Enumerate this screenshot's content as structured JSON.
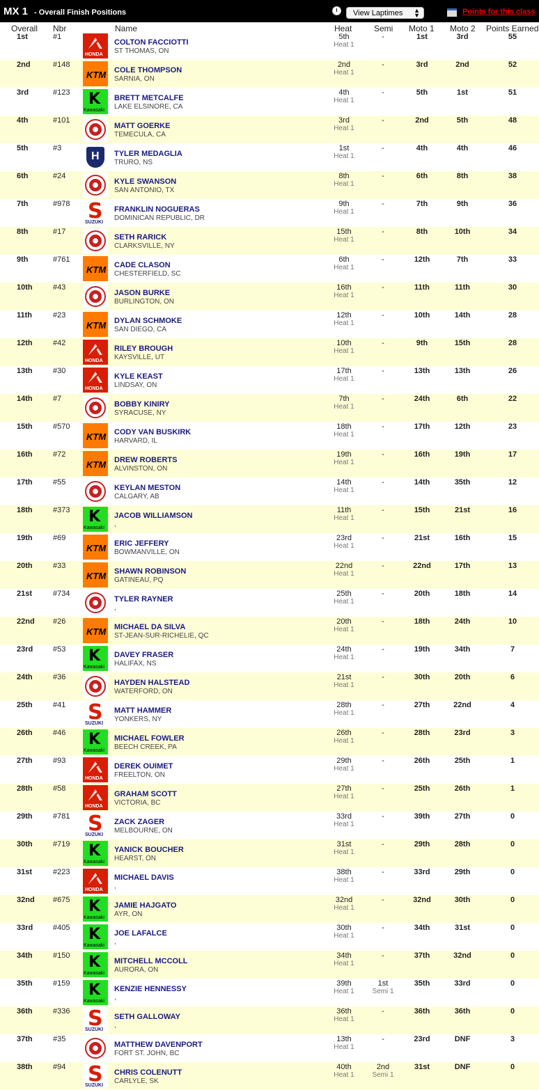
{
  "header": {
    "class_name": "MX 1",
    "subtitle": "- Overall Finish Positions",
    "laptimes_select": "View Laptimes",
    "points_link": "Points for this class"
  },
  "columns": {
    "overall": "Overall",
    "nbr": "Nbr",
    "name": "Name",
    "heat": "Heat",
    "semi": "Semi",
    "moto1": "Moto 1",
    "moto2": "Moto 2",
    "points": "Points Earned"
  },
  "brand_icons": {
    "honda": "honda-logo-icon",
    "ktm": "ktm-logo-icon",
    "kawasaki": "kawasaki-logo-icon",
    "yamaha": "yamaha-logo-icon",
    "husqvarna": "husqvarna-logo-icon",
    "suzuki": "suzuki-logo-icon"
  },
  "rows": [
    {
      "pos": "1st",
      "nbr": "#1",
      "brand": "honda",
      "name": "COLTON FACCIOTTI",
      "hometown": "ST THOMAS, ON",
      "heat": "5th",
      "heat_sub": "Heat 1",
      "semi": "-",
      "semi_sub": "",
      "moto1": "1st",
      "moto2": "3rd",
      "points": "55"
    },
    {
      "pos": "2nd",
      "nbr": "#148",
      "brand": "ktm",
      "name": "COLE THOMPSON",
      "hometown": "SARNIA, ON",
      "heat": "2nd",
      "heat_sub": "Heat 1",
      "semi": "-",
      "semi_sub": "",
      "moto1": "3rd",
      "moto2": "2nd",
      "points": "52"
    },
    {
      "pos": "3rd",
      "nbr": "#123",
      "brand": "kawasaki",
      "name": "BRETT METCALFE",
      "hometown": "LAKE ELSINORE, CA",
      "heat": "4th",
      "heat_sub": "Heat 1",
      "semi": "-",
      "semi_sub": "",
      "moto1": "5th",
      "moto2": "1st",
      "points": "51"
    },
    {
      "pos": "4th",
      "nbr": "#101",
      "brand": "yamaha",
      "name": "MATT GOERKE",
      "hometown": "TEMECULA, CA",
      "heat": "3rd",
      "heat_sub": "Heat 1",
      "semi": "-",
      "semi_sub": "",
      "moto1": "2nd",
      "moto2": "5th",
      "points": "48"
    },
    {
      "pos": "5th",
      "nbr": "#3",
      "brand": "husqvarna",
      "name": "TYLER MEDAGLIA",
      "hometown": "TRURO, NS",
      "heat": "1st",
      "heat_sub": "Heat 1",
      "semi": "-",
      "semi_sub": "",
      "moto1": "4th",
      "moto2": "4th",
      "points": "46"
    },
    {
      "pos": "6th",
      "nbr": "#24",
      "brand": "yamaha",
      "name": "KYLE SWANSON",
      "hometown": "SAN ANTONIO, TX",
      "heat": "8th",
      "heat_sub": "Heat 1",
      "semi": "-",
      "semi_sub": "",
      "moto1": "6th",
      "moto2": "8th",
      "points": "38"
    },
    {
      "pos": "7th",
      "nbr": "#978",
      "brand": "suzuki",
      "name": "FRANKLIN NOGUERAS",
      "hometown": "DOMINICAN REPUBLIC, DR",
      "heat": "9th",
      "heat_sub": "Heat 1",
      "semi": "-",
      "semi_sub": "",
      "moto1": "7th",
      "moto2": "9th",
      "points": "36"
    },
    {
      "pos": "8th",
      "nbr": "#17",
      "brand": "yamaha",
      "name": "SETH RARICK",
      "hometown": "CLARKSVILLE, NY",
      "heat": "15th",
      "heat_sub": "Heat 1",
      "semi": "-",
      "semi_sub": "",
      "moto1": "8th",
      "moto2": "10th",
      "points": "34"
    },
    {
      "pos": "9th",
      "nbr": "#761",
      "brand": "ktm",
      "name": "CADE CLASON",
      "hometown": "CHESTERFIELD, SC",
      "heat": "6th",
      "heat_sub": "Heat 1",
      "semi": "-",
      "semi_sub": "",
      "moto1": "12th",
      "moto2": "7th",
      "points": "33"
    },
    {
      "pos": "10th",
      "nbr": "#43",
      "brand": "yamaha",
      "name": "JASON BURKE",
      "hometown": "BURLINGTON, ON",
      "heat": "16th",
      "heat_sub": "Heat 1",
      "semi": "-",
      "semi_sub": "",
      "moto1": "11th",
      "moto2": "11th",
      "points": "30"
    },
    {
      "pos": "11th",
      "nbr": "#23",
      "brand": "ktm",
      "name": "DYLAN SCHMOKE",
      "hometown": "SAN DIEGO, CA",
      "heat": "12th",
      "heat_sub": "Heat 1",
      "semi": "-",
      "semi_sub": "",
      "moto1": "10th",
      "moto2": "14th",
      "points": "28"
    },
    {
      "pos": "12th",
      "nbr": "#42",
      "brand": "honda",
      "name": "RILEY BROUGH",
      "hometown": "KAYSVILLE, UT",
      "heat": "10th",
      "heat_sub": "Heat 1",
      "semi": "-",
      "semi_sub": "",
      "moto1": "9th",
      "moto2": "15th",
      "points": "28"
    },
    {
      "pos": "13th",
      "nbr": "#30",
      "brand": "honda",
      "name": "KYLE KEAST",
      "hometown": "LINDSAY, ON",
      "heat": "17th",
      "heat_sub": "Heat 1",
      "semi": "-",
      "semi_sub": "",
      "moto1": "13th",
      "moto2": "13th",
      "points": "26"
    },
    {
      "pos": "14th",
      "nbr": "#7",
      "brand": "yamaha",
      "name": "BOBBY KINIRY",
      "hometown": "SYRACUSE, NY",
      "heat": "7th",
      "heat_sub": "Heat 1",
      "semi": "-",
      "semi_sub": "",
      "moto1": "24th",
      "moto2": "6th",
      "points": "22"
    },
    {
      "pos": "15th",
      "nbr": "#570",
      "brand": "ktm",
      "name": "CODY VAN BUSKIRK",
      "hometown": "HARVARD, IL",
      "heat": "18th",
      "heat_sub": "Heat 1",
      "semi": "-",
      "semi_sub": "",
      "moto1": "17th",
      "moto2": "12th",
      "points": "23"
    },
    {
      "pos": "16th",
      "nbr": "#72",
      "brand": "ktm",
      "name": "DREW ROBERTS",
      "hometown": "ALVINSTON, ON",
      "heat": "19th",
      "heat_sub": "Heat 1",
      "semi": "-",
      "semi_sub": "",
      "moto1": "16th",
      "moto2": "19th",
      "points": "17"
    },
    {
      "pos": "17th",
      "nbr": "#55",
      "brand": "yamaha",
      "name": "KEYLAN MESTON",
      "hometown": "CALGARY, AB",
      "heat": "14th",
      "heat_sub": "Heat 1",
      "semi": "-",
      "semi_sub": "",
      "moto1": "14th",
      "moto2": "35th",
      "points": "12"
    },
    {
      "pos": "18th",
      "nbr": "#373",
      "brand": "kawasaki",
      "name": "JACOB WILLIAMSON",
      "hometown": ",",
      "heat": "11th",
      "heat_sub": "Heat 1",
      "semi": "-",
      "semi_sub": "",
      "moto1": "15th",
      "moto2": "21st",
      "points": "16"
    },
    {
      "pos": "19th",
      "nbr": "#69",
      "brand": "ktm",
      "name": "ERIC JEFFERY",
      "hometown": "BOWMANVILLE, ON",
      "heat": "23rd",
      "heat_sub": "Heat 1",
      "semi": "-",
      "semi_sub": "",
      "moto1": "21st",
      "moto2": "16th",
      "points": "15"
    },
    {
      "pos": "20th",
      "nbr": "#33",
      "brand": "ktm",
      "name": "SHAWN ROBINSON",
      "hometown": "GATINEAU, PQ",
      "heat": "22nd",
      "heat_sub": "Heat 1",
      "semi": "-",
      "semi_sub": "",
      "moto1": "22nd",
      "moto2": "17th",
      "points": "13"
    },
    {
      "pos": "21st",
      "nbr": "#734",
      "brand": "yamaha",
      "name": "TYLER RAYNER",
      "hometown": ",",
      "heat": "25th",
      "heat_sub": "Heat 1",
      "semi": "-",
      "semi_sub": "",
      "moto1": "20th",
      "moto2": "18th",
      "points": "14"
    },
    {
      "pos": "22nd",
      "nbr": "#26",
      "brand": "ktm",
      "name": "MICHAEL DA SILVA",
      "hometown": "ST-JEAN-SUR-RICHELIE, QC",
      "heat": "20th",
      "heat_sub": "Heat 1",
      "semi": "-",
      "semi_sub": "",
      "moto1": "18th",
      "moto2": "24th",
      "points": "10"
    },
    {
      "pos": "23rd",
      "nbr": "#53",
      "brand": "kawasaki",
      "name": "DAVEY FRASER",
      "hometown": "HALIFAX, NS",
      "heat": "24th",
      "heat_sub": "Heat 1",
      "semi": "-",
      "semi_sub": "",
      "moto1": "19th",
      "moto2": "34th",
      "points": "7"
    },
    {
      "pos": "24th",
      "nbr": "#36",
      "brand": "yamaha",
      "name": "HAYDEN HALSTEAD",
      "hometown": "WATERFORD, ON",
      "heat": "21st",
      "heat_sub": "Heat 1",
      "semi": "-",
      "semi_sub": "",
      "moto1": "30th",
      "moto2": "20th",
      "points": "6"
    },
    {
      "pos": "25th",
      "nbr": "#41",
      "brand": "suzuki",
      "name": "MATT HAMMER",
      "hometown": "YONKERS, NY",
      "heat": "28th",
      "heat_sub": "Heat 1",
      "semi": "-",
      "semi_sub": "",
      "moto1": "27th",
      "moto2": "22nd",
      "points": "4"
    },
    {
      "pos": "26th",
      "nbr": "#46",
      "brand": "kawasaki",
      "name": "MICHAEL FOWLER",
      "hometown": "BEECH CREEK, PA",
      "heat": "26th",
      "heat_sub": "Heat 1",
      "semi": "-",
      "semi_sub": "",
      "moto1": "28th",
      "moto2": "23rd",
      "points": "3"
    },
    {
      "pos": "27th",
      "nbr": "#93",
      "brand": "honda",
      "name": "DEREK OUIMET",
      "hometown": "FREELTON, ON",
      "heat": "29th",
      "heat_sub": "Heat 1",
      "semi": "-",
      "semi_sub": "",
      "moto1": "26th",
      "moto2": "25th",
      "points": "1"
    },
    {
      "pos": "28th",
      "nbr": "#58",
      "brand": "honda",
      "name": "GRAHAM SCOTT",
      "hometown": "VICTORIA, BC",
      "heat": "27th",
      "heat_sub": "Heat 1",
      "semi": "-",
      "semi_sub": "",
      "moto1": "25th",
      "moto2": "26th",
      "points": "1"
    },
    {
      "pos": "29th",
      "nbr": "#781",
      "brand": "suzuki",
      "name": "ZACK ZAGER",
      "hometown": "MELBOURNE, ON",
      "heat": "33rd",
      "heat_sub": "Heat 1",
      "semi": "-",
      "semi_sub": "",
      "moto1": "39th",
      "moto2": "27th",
      "points": "0"
    },
    {
      "pos": "30th",
      "nbr": "#719",
      "brand": "kawasaki",
      "name": "YANICK BOUCHER",
      "hometown": "HEARST, ON",
      "heat": "31st",
      "heat_sub": "Heat 1",
      "semi": "-",
      "semi_sub": "",
      "moto1": "29th",
      "moto2": "28th",
      "points": "0"
    },
    {
      "pos": "31st",
      "nbr": "#223",
      "brand": "honda",
      "name": "MICHAEL DAVIS",
      "hometown": ",",
      "heat": "38th",
      "heat_sub": "Heat 1",
      "semi": "-",
      "semi_sub": "",
      "moto1": "33rd",
      "moto2": "29th",
      "points": "0"
    },
    {
      "pos": "32nd",
      "nbr": "#675",
      "brand": "kawasaki",
      "name": "JAMIE HAJGATO",
      "hometown": "AYR, ON",
      "heat": "32nd",
      "heat_sub": "Heat 1",
      "semi": "-",
      "semi_sub": "",
      "moto1": "32nd",
      "moto2": "30th",
      "points": "0"
    },
    {
      "pos": "33rd",
      "nbr": "#405",
      "brand": "kawasaki",
      "name": "JOE LAFALCE",
      "hometown": ",",
      "heat": "30th",
      "heat_sub": "Heat 1",
      "semi": "-",
      "semi_sub": "",
      "moto1": "34th",
      "moto2": "31st",
      "points": "0"
    },
    {
      "pos": "34th",
      "nbr": "#150",
      "brand": "kawasaki",
      "name": "MITCHELL MCCOLL",
      "hometown": "AURORA, ON",
      "heat": "34th",
      "heat_sub": "Heat 1",
      "semi": "-",
      "semi_sub": "",
      "moto1": "37th",
      "moto2": "32nd",
      "points": "0"
    },
    {
      "pos": "35th",
      "nbr": "#159",
      "brand": "kawasaki",
      "name": "KENZIE HENNESSY",
      "hometown": ",",
      "heat": "39th",
      "heat_sub": "Heat 1",
      "semi": "1st",
      "semi_sub": "Semi 1",
      "moto1": "35th",
      "moto2": "33rd",
      "points": "0"
    },
    {
      "pos": "36th",
      "nbr": "#336",
      "brand": "suzuki",
      "name": "SETH GALLOWAY",
      "hometown": ",",
      "heat": "36th",
      "heat_sub": "Heat 1",
      "semi": "-",
      "semi_sub": "",
      "moto1": "36th",
      "moto2": "36th",
      "points": "0"
    },
    {
      "pos": "37th",
      "nbr": "#35",
      "brand": "yamaha",
      "name": "MATTHEW DAVENPORT",
      "hometown": "FORT ST. JOHN, BC",
      "heat": "13th",
      "heat_sub": "Heat 1",
      "semi": "-",
      "semi_sub": "",
      "moto1": "23rd",
      "moto2": "DNF",
      "points": "3"
    },
    {
      "pos": "38th",
      "nbr": "#94",
      "brand": "suzuki",
      "name": "CHRIS COLENUTT",
      "hometown": "CARLYLE, SK",
      "heat": "40th",
      "heat_sub": "Heat 1",
      "semi": "2nd",
      "semi_sub": "Semi 1",
      "moto1": "31st",
      "moto2": "DNF",
      "points": "0"
    }
  ]
}
